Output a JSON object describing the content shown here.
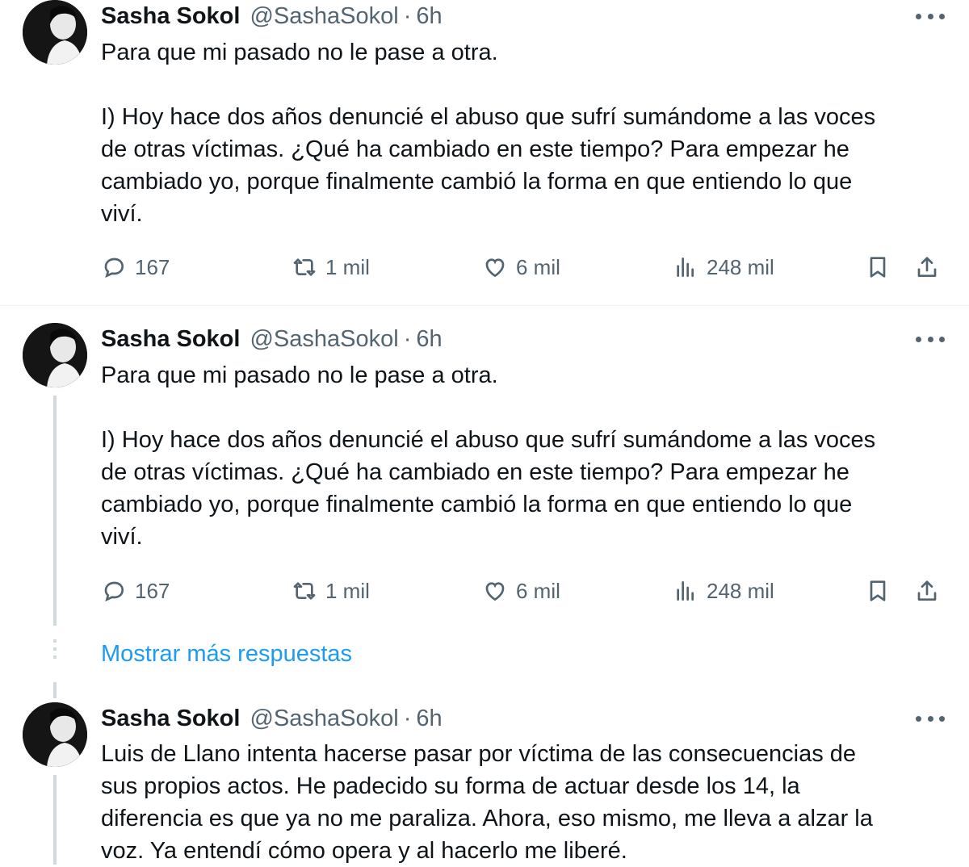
{
  "tweets": [
    {
      "name": "Sasha Sokol",
      "handle": "@SashaSokol",
      "separator": "·",
      "time": "6h",
      "text": "Para que mi pasado no le pase a otra.\n\nI) Hoy hace dos años denuncié el abuso que sufrí sumándome a las voces\nde otras víctimas. ¿Qué ha cambiado en este tiempo? Para empezar he\ncambiado yo, porque finalmente cambió la forma en que entiendo lo que\nviví.",
      "replies": "167",
      "retweets": "1 mil",
      "likes": "6 mil",
      "views": "248 mil"
    },
    {
      "name": "Sasha Sokol",
      "handle": "@SashaSokol",
      "separator": "·",
      "time": "6h",
      "text": "Para que mi pasado no le pase a otra.\n\nI) Hoy hace dos años denuncié el abuso que sufrí sumándome a las voces\nde otras víctimas. ¿Qué ha cambiado en este tiempo? Para empezar he\ncambiado yo, porque finalmente cambió la forma en que entiendo lo que\nviví.",
      "replies": "167",
      "retweets": "1 mil",
      "likes": "6 mil",
      "views": "248 mil"
    },
    {
      "name": "Sasha Sokol",
      "handle": "@SashaSokol",
      "separator": "·",
      "time": "6h",
      "text": "Luis de Llano intenta hacerse pasar por víctima de las consecuencias de\nsus propios actos. He padecido su forma de actuar desde los 14, la\ndiferencia es que ya no me paraliza. Ahora, eso mismo, me lleva a alzar la\nvoz. Ya entendí cómo opera y al hacerlo me liberé."
    }
  ],
  "thread": {
    "show_more_label": "Mostrar más respuestas"
  },
  "icons": {
    "reply": "speech-bubble",
    "retweet": "retweet-arrows",
    "like": "heart-outline",
    "views": "bar-chart",
    "bookmark": "bookmark-outline",
    "share": "share-upload",
    "more": "three-dots"
  },
  "colors": {
    "text": "#0f1419",
    "secondary": "#536471",
    "link": "#1d9bf0",
    "divider": "#eff3f4",
    "thread_line": "#cfd9de"
  }
}
